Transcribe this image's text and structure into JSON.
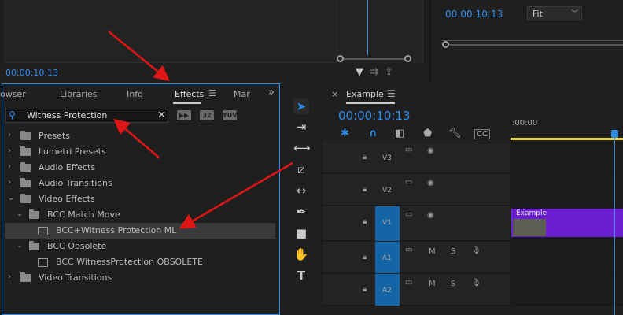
{
  "source_monitor": {
    "timecode": "00:00:10:13"
  },
  "program_monitor": {
    "timecode": "00:00:10:13",
    "zoom": "Fit"
  },
  "effects_panel": {
    "tabs": [
      "owser",
      "Libraries",
      "Info",
      "Effects",
      "Mar"
    ],
    "menu_glyph": "☰",
    "overflow_glyph": "»",
    "search": {
      "value": "Witness Protection",
      "clear": "✕",
      "icon": "search-icon"
    },
    "badges": [
      "32",
      "YUV"
    ],
    "tree": [
      {
        "label": "Presets",
        "level": 0,
        "open": false,
        "kind": "star-folder"
      },
      {
        "label": "Lumetri Presets",
        "level": 0,
        "open": false,
        "kind": "star-folder"
      },
      {
        "label": "Audio Effects",
        "level": 0,
        "open": false,
        "kind": "folder"
      },
      {
        "label": "Audio Transitions",
        "level": 0,
        "open": false,
        "kind": "folder"
      },
      {
        "label": "Video Effects",
        "level": 0,
        "open": true,
        "kind": "folder"
      },
      {
        "label": "BCC Match Move",
        "level": 1,
        "open": true,
        "kind": "folder"
      },
      {
        "label": "BCC+Witness Protection ML",
        "level": 2,
        "kind": "effect",
        "selected": true
      },
      {
        "label": "BCC Obsolete",
        "level": 1,
        "open": true,
        "kind": "folder"
      },
      {
        "label": "BCC WitnessProtection OBSOLETE",
        "level": 2,
        "kind": "effect"
      },
      {
        "label": "Video Transitions",
        "level": 0,
        "open": false,
        "kind": "folder"
      }
    ]
  },
  "timeline": {
    "close": "×",
    "sequence_name": "Example",
    "menu_glyph": "☰",
    "timecode": "00:00:10:13",
    "ruler_label": ":00:00",
    "tracks": [
      {
        "name": "V3"
      },
      {
        "name": "V2"
      },
      {
        "name": "V1"
      },
      {
        "name": "A1",
        "m": "M",
        "s": "S"
      },
      {
        "name": "A2",
        "m": "M",
        "s": "S"
      }
    ],
    "clip": {
      "label": "Example"
    }
  },
  "colors": {
    "accent": "#2d8ceb",
    "clip": "#6a20cf",
    "arrow": "#e01515",
    "workbar": "#e8d33a"
  }
}
